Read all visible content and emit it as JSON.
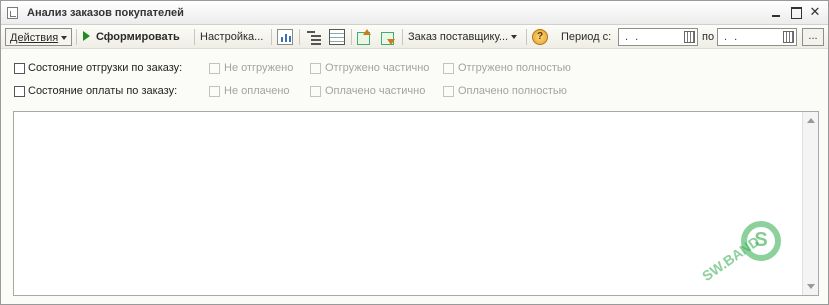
{
  "window": {
    "title": "Анализ заказов покупателей",
    "icon": "report-form-icon",
    "close_glyph": "✕"
  },
  "toolbar": {
    "actions_label": "Действия",
    "generate_label": "Сформировать",
    "settings_label": "Настройка...",
    "supplier_order_label": "Заказ поставщику...",
    "help_glyph": "?",
    "period_from_label": "Период с:",
    "period_to_label": "по",
    "date_from_value": ". .",
    "date_to_value": ". .",
    "more_label": "...",
    "icons": [
      "report-icon",
      "tree-icon",
      "table-icon",
      "move-up-icon",
      "move-down-icon",
      "help-icon",
      "calendar-icon"
    ]
  },
  "filters": {
    "shipment": {
      "label": "Состояние отгрузки по заказу:",
      "options": [
        "Не отгружено",
        "Отгружено частично",
        "Отгружено полностью"
      ]
    },
    "payment": {
      "label": "Состояние оплаты по заказу:",
      "options": [
        "Не оплачено",
        "Оплачено частично",
        "Оплачено полностью"
      ]
    }
  },
  "watermark": {
    "text": "SW.BAND",
    "color": "#2eaa48"
  },
  "colors": {
    "generate_icon": "#1f8c1f",
    "disabled_text": "#a3a3a3"
  }
}
